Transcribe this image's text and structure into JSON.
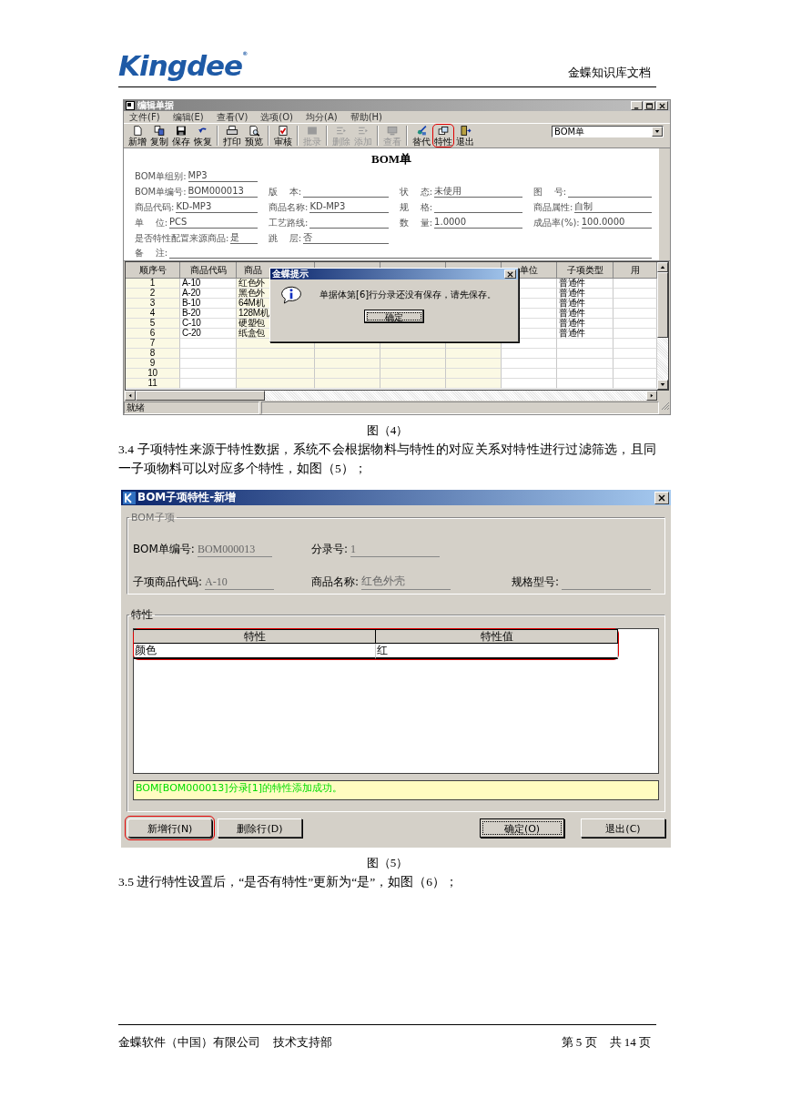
{
  "header": {
    "logo": "Kingdee",
    "logo_mark": "®",
    "title": "金蝶知识库文档"
  },
  "figure4": {
    "window": {
      "title": "编辑单据"
    },
    "menu": [
      "文件(F)",
      "编辑(E)",
      "查看(V)",
      "选项(O)",
      "均分(A)",
      "帮助(H)"
    ],
    "toolbar": [
      {
        "kind": "button",
        "label": "新增",
        "disabled": false,
        "circled": false
      },
      {
        "kind": "button",
        "label": "复制",
        "disabled": false,
        "circled": false
      },
      {
        "kind": "button",
        "label": "保存",
        "disabled": false,
        "circled": false
      },
      {
        "kind": "button",
        "label": "恢复",
        "disabled": false,
        "circled": false
      },
      {
        "kind": "separator"
      },
      {
        "kind": "button",
        "label": "打印",
        "disabled": false,
        "circled": false
      },
      {
        "kind": "button",
        "label": "预览",
        "disabled": false,
        "circled": false
      },
      {
        "kind": "separator"
      },
      {
        "kind": "button",
        "label": "审核",
        "disabled": false,
        "circled": false
      },
      {
        "kind": "separator"
      },
      {
        "kind": "button",
        "label": "批录",
        "disabled": true,
        "circled": false
      },
      {
        "kind": "separator"
      },
      {
        "kind": "button",
        "label": "删除",
        "disabled": true,
        "circled": false
      },
      {
        "kind": "button",
        "label": "添加",
        "disabled": true,
        "circled": false
      },
      {
        "kind": "separator"
      },
      {
        "kind": "button",
        "label": "查看",
        "disabled": true,
        "circled": false
      },
      {
        "kind": "separator"
      },
      {
        "kind": "button",
        "label": "替代",
        "disabled": false,
        "circled": false
      },
      {
        "kind": "button",
        "label": "特性",
        "disabled": false,
        "circled": true
      },
      {
        "kind": "button",
        "label": "退出",
        "disabled": false,
        "circled": false
      }
    ],
    "bill_type": "BOM单",
    "form_title": "BOM单",
    "form_rows": [
      [
        {
          "label": "BOM单组别:",
          "value": "MP3"
        }
      ],
      [
        {
          "label": "BOM单编号:",
          "value": "BOM000013"
        },
        {
          "label": "版    本:"
        },
        {
          "label": "状    态:",
          "value": "未使用"
        },
        {
          "label": "图    号:"
        }
      ],
      [
        {
          "label": "商品代码:",
          "value": "KD-MP3"
        },
        {
          "label": "商品名称:",
          "value": "KD-MP3"
        },
        {
          "label": "规    格:"
        },
        {
          "label": "商品属性:",
          "value": "自制"
        }
      ],
      [
        {
          "label": "单    位:",
          "value": "PCS"
        },
        {
          "label": "工艺路线:"
        },
        {
          "label": "数    量:",
          "value": "1.0000"
        },
        {
          "label": "成品率(%):",
          "value": "100.0000"
        }
      ],
      [
        {
          "label": "是否特性配置来源商品:",
          "value": "是"
        },
        {
          "label": "跳    层:",
          "value": "否"
        }
      ]
    ],
    "note_label": "备    注:",
    "table": {
      "columns": [
        {
          "label": "顺序号"
        },
        {
          "label": "商品代码"
        },
        {
          "label": "商品"
        },
        {},
        {},
        {},
        {
          "label": "单位"
        },
        {
          "label": "子项类型"
        },
        {
          "label": "用"
        }
      ],
      "rows": [
        {
          "seq": "1",
          "code": "A-10",
          "name": "红色外",
          "item_type": "普通件"
        },
        {
          "seq": "2",
          "code": "A-20",
          "name": "黑色外",
          "item_type": "普通件"
        },
        {
          "seq": "3",
          "code": "B-10",
          "name": "64M机",
          "item_type": "普通件"
        },
        {
          "seq": "4",
          "code": "B-20",
          "name": "128M机",
          "item_type": "普通件"
        },
        {
          "seq": "5",
          "code": "C-10",
          "name": "硬塑包",
          "item_type": "普通件"
        },
        {
          "seq": "6",
          "code": "C-20",
          "name": "纸盒包",
          "item_type": "普通件"
        },
        {
          "seq": "7"
        },
        {
          "seq": "8"
        },
        {
          "seq": "9"
        },
        {
          "seq": "10"
        },
        {
          "seq": "11"
        }
      ]
    },
    "dialog": {
      "title": "金蝶提示",
      "message": "单据体第[6]行分录还没有保存，请先保存。",
      "button": "确定"
    },
    "status": "就绪"
  },
  "caption4": "图（4）",
  "para1": "3.4 子项特性来源于特性数据，系统不会根据物料与特性的对应关系对特性进行过滤筛选，且同一子项物料可以对应多个特性，如图（5）；",
  "figure5": {
    "window": {
      "title": "BOM子项特性-新增"
    },
    "group1": {
      "title": "BOM子项",
      "rows": [
        [
          {
            "label": "BOM单编号:",
            "value": "BOM000013"
          },
          {
            "label": "分录号:",
            "value": "1"
          }
        ],
        [
          {
            "label": "子项商品代码:",
            "value": "A-10"
          },
          {
            "label": "商品名称:",
            "value": "红色外壳"
          },
          {
            "label": "规格型号:"
          }
        ]
      ]
    },
    "group2": {
      "title": "特性",
      "columns": [
        "特性",
        "特性值"
      ],
      "rows": [
        {
          "cells": [
            "颜色",
            "红"
          ]
        }
      ],
      "circled": true
    },
    "message": "BOM[BOM000013]分录[1]的特性添加成功。",
    "buttons": [
      {
        "label": "新增行(N)",
        "circled": true,
        "default": false
      },
      {
        "label": "删除行(D)",
        "circled": false,
        "default": false
      },
      {
        "label": "确定(O)",
        "circled": false,
        "default": true
      },
      {
        "label": "退出(C)",
        "circled": false,
        "default": false
      }
    ]
  },
  "caption5": "图（5）",
  "para2": "3.5 进行特性设置后，“是否有特性”更新为“是”，如图（6）；",
  "footer": {
    "company": "金蝶软件（中国）有限公司",
    "dept": "技术支持部",
    "page": "第 5 页",
    "total": "共 14 页"
  }
}
